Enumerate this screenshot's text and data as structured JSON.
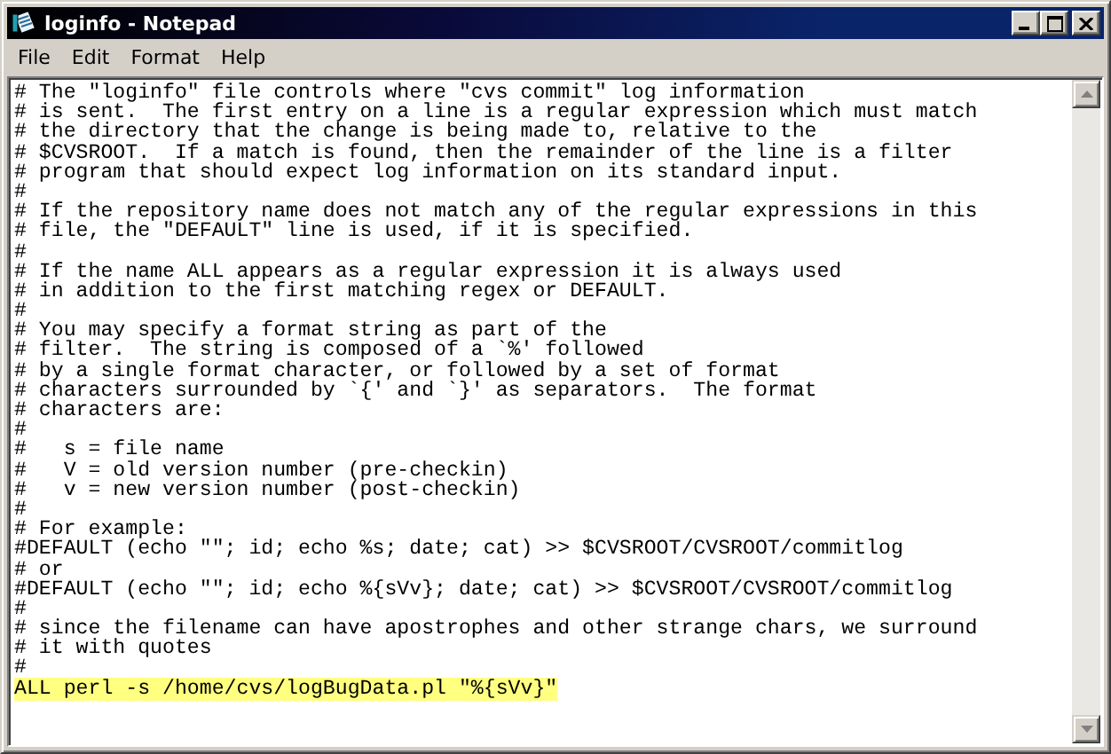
{
  "window": {
    "title": "loginfo - Notepad"
  },
  "menu": [
    {
      "label": "File"
    },
    {
      "label": "Edit"
    },
    {
      "label": "Format"
    },
    {
      "label": "Help"
    }
  ],
  "editor": {
    "lines": [
      {
        "text": "# The \"loginfo\" file controls where \"cvs commit\" log information",
        "selected": false
      },
      {
        "text": "# is sent.  The first entry on a line is a regular expression which must match",
        "selected": false
      },
      {
        "text": "# the directory that the change is being made to, relative to the",
        "selected": false
      },
      {
        "text": "# $CVSROOT.  If a match is found, then the remainder of the line is a filter",
        "selected": false
      },
      {
        "text": "# program that should expect log information on its standard input.",
        "selected": false
      },
      {
        "text": "#",
        "selected": false
      },
      {
        "text": "# If the repository name does not match any of the regular expressions in this",
        "selected": false
      },
      {
        "text": "# file, the \"DEFAULT\" line is used, if it is specified.",
        "selected": false
      },
      {
        "text": "#",
        "selected": false
      },
      {
        "text": "# If the name ALL appears as a regular expression it is always used",
        "selected": false
      },
      {
        "text": "# in addition to the first matching regex or DEFAULT.",
        "selected": false
      },
      {
        "text": "#",
        "selected": false
      },
      {
        "text": "# You may specify a format string as part of the",
        "selected": false
      },
      {
        "text": "# filter.  The string is composed of a `%' followed",
        "selected": false
      },
      {
        "text": "# by a single format character, or followed by a set of format",
        "selected": false
      },
      {
        "text": "# characters surrounded by `{' and `}' as separators.  The format",
        "selected": false
      },
      {
        "text": "# characters are:",
        "selected": false
      },
      {
        "text": "#",
        "selected": false
      },
      {
        "text": "#   s = file name",
        "selected": false
      },
      {
        "text": "#   V = old version number (pre-checkin)",
        "selected": false
      },
      {
        "text": "#   v = new version number (post-checkin)",
        "selected": false
      },
      {
        "text": "#",
        "selected": false
      },
      {
        "text": "# For example:",
        "selected": false
      },
      {
        "text": "#DEFAULT (echo \"\"; id; echo %s; date; cat) >> $CVSROOT/CVSROOT/commitlog",
        "selected": false
      },
      {
        "text": "# or",
        "selected": false
      },
      {
        "text": "#DEFAULT (echo \"\"; id; echo %{sVv}; date; cat) >> $CVSROOT/CVSROOT/commitlog",
        "selected": false
      },
      {
        "text": "#",
        "selected": false
      },
      {
        "text": "# since the filename can have apostrophes and other strange chars, we surround",
        "selected": false
      },
      {
        "text": "# it with quotes",
        "selected": false
      },
      {
        "text": "#",
        "selected": false
      },
      {
        "text": "ALL perl -s /home/cvs/logBugData.pl \"%{sVv}\"",
        "selected": true
      }
    ]
  }
}
